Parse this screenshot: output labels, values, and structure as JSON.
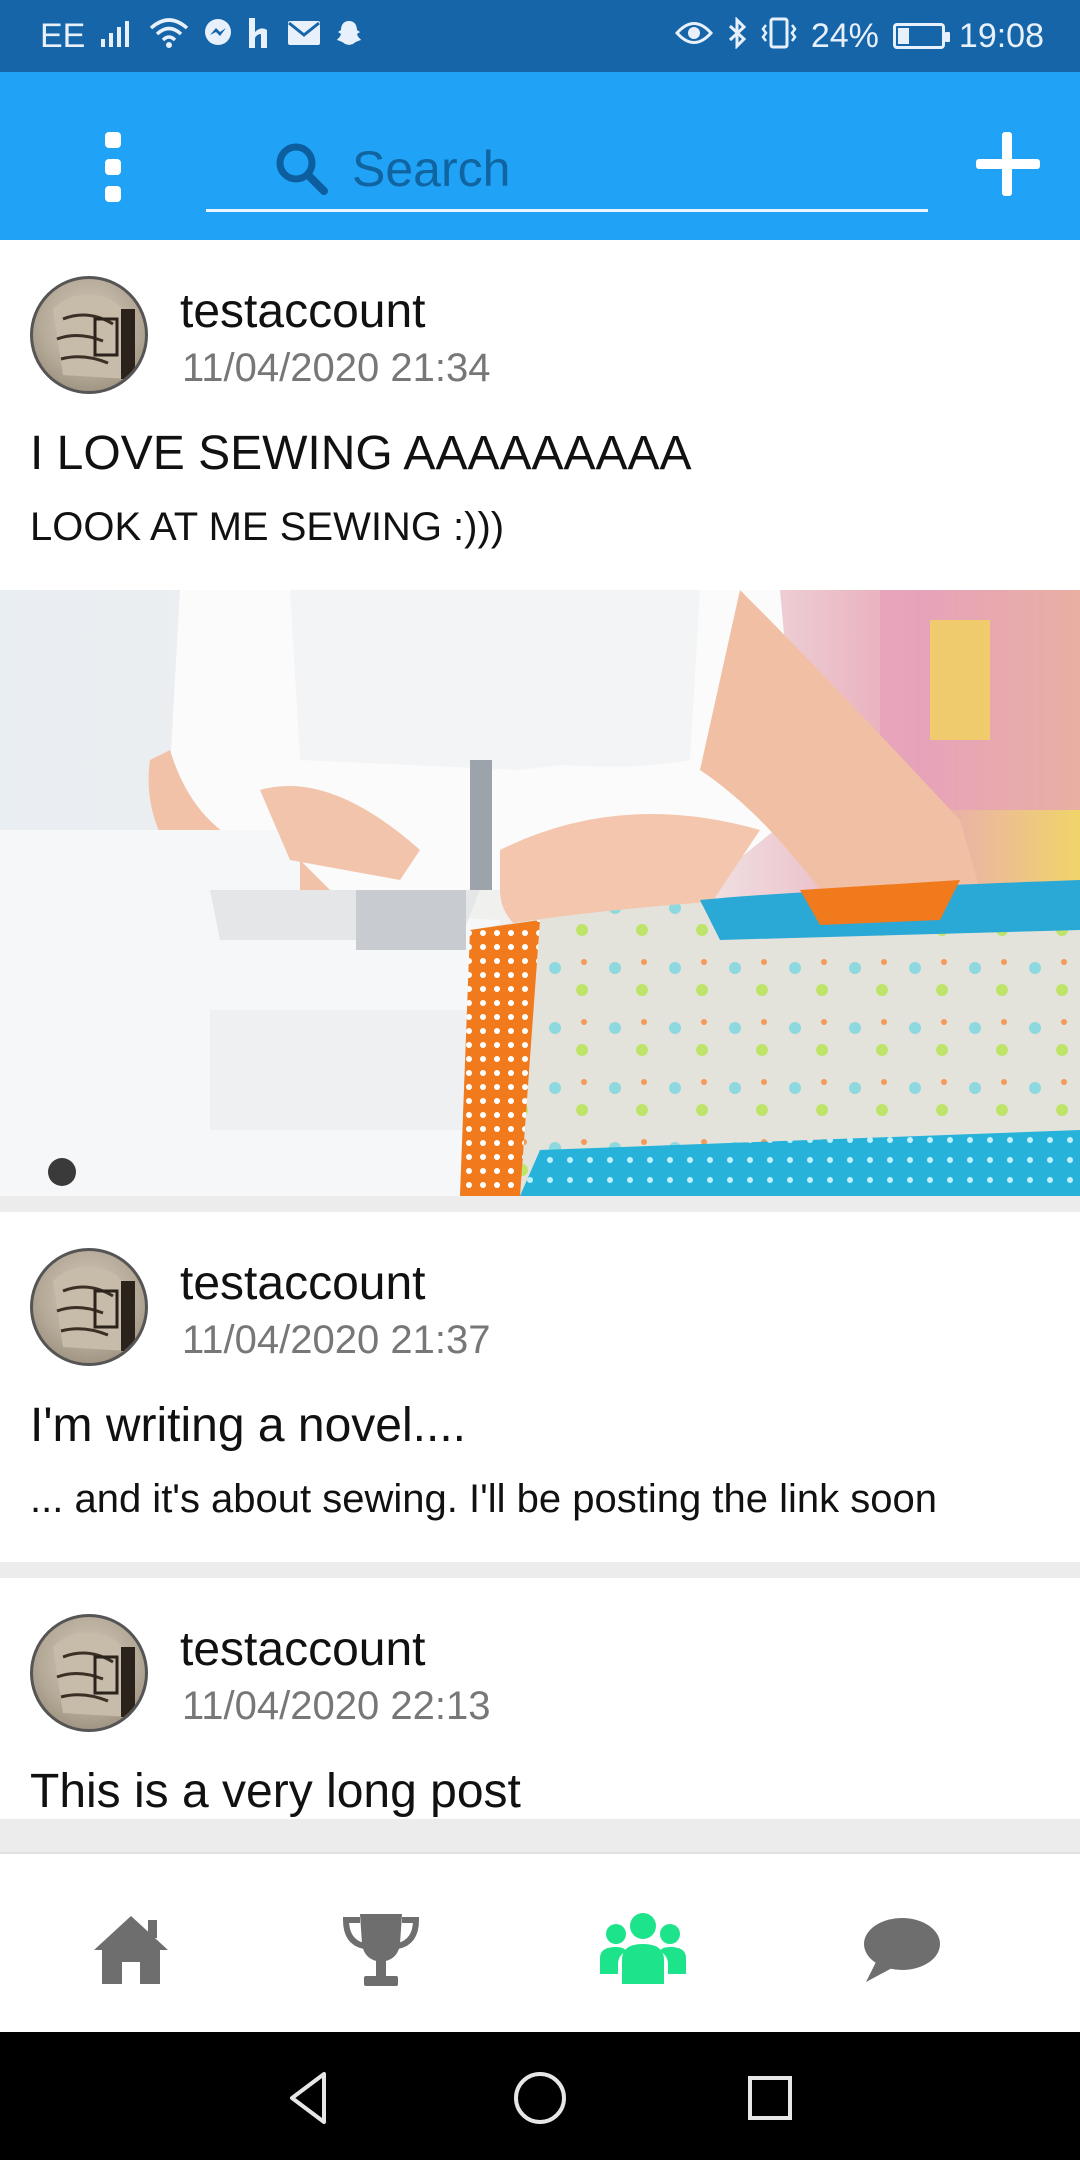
{
  "status_bar": {
    "carrier": "EE",
    "battery_percent": "24%",
    "time": "19:08",
    "left_icons": [
      "signal-icon",
      "wifi-icon",
      "messenger-icon",
      "h-icon",
      "mail-icon",
      "snapchat-icon"
    ],
    "right_icons": [
      "eye-icon",
      "bluetooth-icon",
      "vibrate-icon",
      "battery-icon"
    ]
  },
  "app_bar": {
    "color": "#20a3f7",
    "search_placeholder": "Search",
    "menu_icon": "more-vertical-icon",
    "add_icon": "plus-icon"
  },
  "posts": [
    {
      "username": "testaccount",
      "timestamp": "11/04/2020 21:34",
      "title": "I LOVE SEWING AAAAAAAAA",
      "body": "LOOK AT ME SEWING :)))",
      "has_image": true,
      "image_subject": "sewing-machine-photo"
    },
    {
      "username": "testaccount",
      "timestamp": "11/04/2020 21:37",
      "title": "I'm writing a novel....",
      "body": "... and it's about sewing. I'll be posting the link soon",
      "has_image": false
    },
    {
      "username": "testaccount",
      "timestamp": "11/04/2020 22:13",
      "title": "This is a very long post",
      "body": "",
      "has_image": false
    }
  ],
  "bottom_nav": {
    "items": [
      {
        "icon": "home-icon",
        "active": false
      },
      {
        "icon": "trophy-icon",
        "active": false
      },
      {
        "icon": "groups-icon",
        "active": true
      },
      {
        "icon": "chat-icon",
        "active": false
      }
    ],
    "active_color": "#1de38a",
    "inactive_color": "#6e6e6e"
  }
}
